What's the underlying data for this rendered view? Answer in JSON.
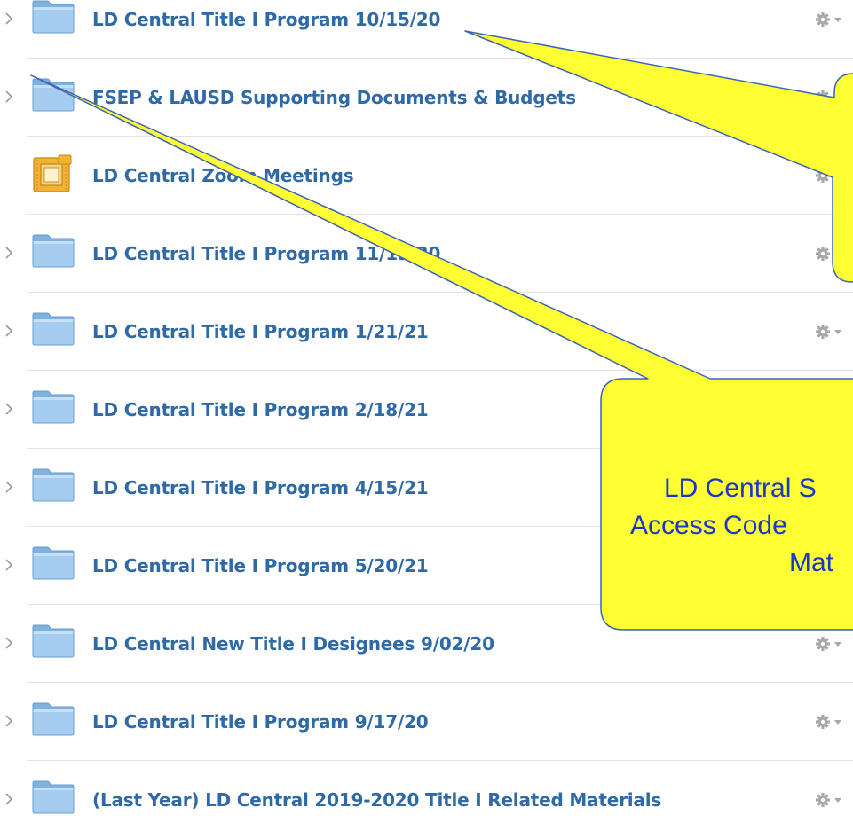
{
  "rows": [
    {
      "label": "LD Central Title I Program 10/15/20",
      "icon": "folder-icon",
      "expandable": true,
      "has_gear": true
    },
    {
      "label": "FSEP & LAUSD Supporting Documents & Budgets",
      "icon": "folder-icon",
      "expandable": true,
      "has_gear": true
    },
    {
      "label": "LD Central Zoom Meetings",
      "icon": "zoom-meetings-icon",
      "expandable": false,
      "has_gear": true
    },
    {
      "label": "LD Central Title I Program 11/19/20",
      "icon": "folder-icon",
      "expandable": true,
      "has_gear": true
    },
    {
      "label": "LD Central Title I Program 1/21/21",
      "icon": "folder-icon",
      "expandable": true,
      "has_gear": true
    },
    {
      "label": "LD Central Title I Program 2/18/21",
      "icon": "folder-icon",
      "expandable": true,
      "has_gear": true
    },
    {
      "label": "LD Central Title I Program 4/15/21",
      "icon": "folder-icon",
      "expandable": true,
      "has_gear": true
    },
    {
      "label": "LD Central Title I Program 5/20/21",
      "icon": "folder-icon",
      "expandable": true,
      "has_gear": true
    },
    {
      "label": "LD Central New Title I Designees 9/02/20",
      "icon": "folder-icon",
      "expandable": true,
      "has_gear": true
    },
    {
      "label": "LD Central Title I Program 9/17/20",
      "icon": "folder-icon",
      "expandable": true,
      "has_gear": true
    },
    {
      "label": "(Last Year) LD Central 2019-2020 Title I Related Materials",
      "icon": "folder-icon",
      "expandable": true,
      "has_gear": true
    }
  ],
  "callout_bottom": {
    "line1": "LD Central S",
    "line2": "Access Code",
    "line3": "Mat"
  },
  "colors": {
    "link": "#2f6aa7",
    "callout_fill": "#ffff33",
    "callout_stroke": "#3d64b4",
    "callout_text": "#1a37c8"
  }
}
